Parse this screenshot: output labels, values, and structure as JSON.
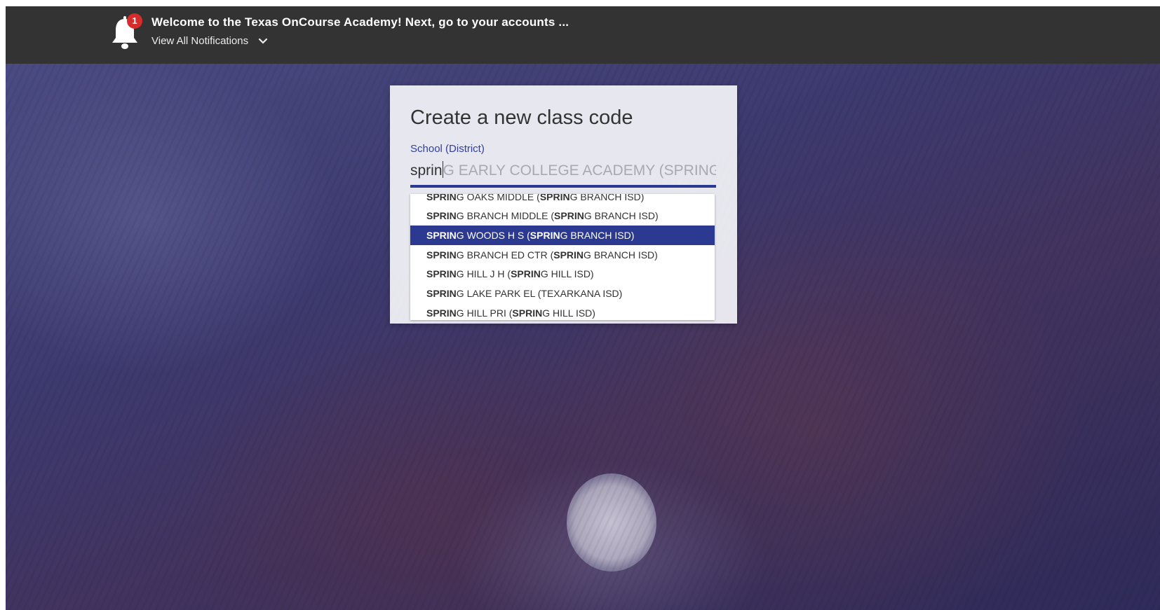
{
  "notification": {
    "count": "1",
    "title": "Welcome to the Texas OnCourse Academy! Next, go to your accounts ...",
    "view_all": "View All Notifications"
  },
  "modal": {
    "title": "Create a new class code",
    "field_label": "School (District)",
    "input_typed": "sprin",
    "input_suggestion": "G EARLY COLLEGE ACADEMY (SPRING ISD)"
  },
  "dropdown": {
    "items": [
      {
        "b1": "SPRIN",
        "m1": "G OAKS MIDDLE (",
        "b2": "SPRIN",
        "m2": "G BRANCH ISD)"
      },
      {
        "b1": "SPRIN",
        "m1": "G BRANCH MIDDLE (",
        "b2": "SPRIN",
        "m2": "G BRANCH ISD)"
      },
      {
        "b1": "SPRIN",
        "m1": "G WOODS H S (",
        "b2": "SPRIN",
        "m2": "G BRANCH ISD)"
      },
      {
        "b1": "SPRIN",
        "m1": "G BRANCH ED CTR (",
        "b2": "SPRIN",
        "m2": "G BRANCH ISD)"
      },
      {
        "b1": "SPRIN",
        "m1": "G HILL J H (",
        "b2": "SPRIN",
        "m2": "G HILL ISD)"
      },
      {
        "b1": "SPRIN",
        "m1": "G LAKE PARK EL (TEXARKANA ISD)",
        "b2": "",
        "m2": ""
      },
      {
        "b1": "SPRIN",
        "m1": "G HILL PRI (",
        "b2": "SPRIN",
        "m2": "G HILL ISD)"
      }
    ],
    "selected_index": 2
  },
  "colors": {
    "topbar": "#333333",
    "accent": "#2b3990",
    "badge": "#d62c2c"
  }
}
